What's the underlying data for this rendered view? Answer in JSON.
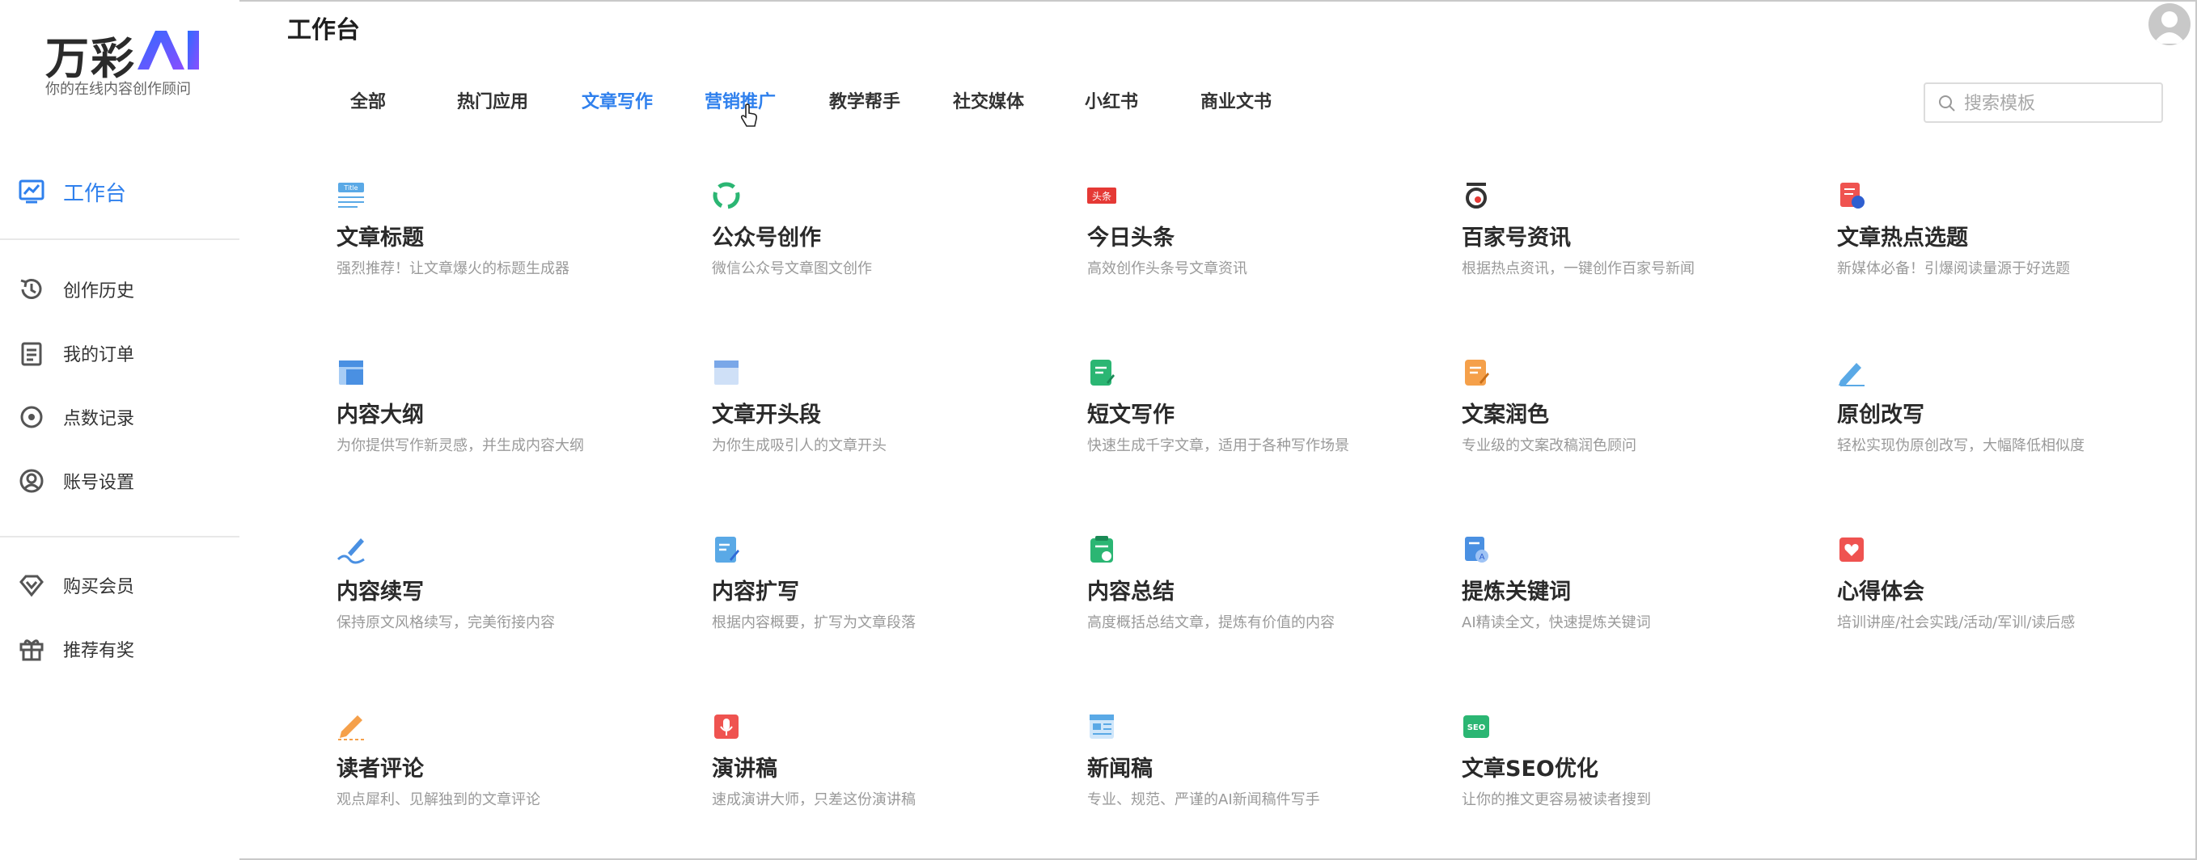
{
  "brand": {
    "name": "万彩",
    "ai": "AI",
    "tagline": "你的在线内容创作顾问"
  },
  "header": {
    "title": "工作台"
  },
  "sidebar": {
    "items": [
      {
        "label": "工作台",
        "icon": "dashboard-chart-icon"
      },
      {
        "label": "创作历史",
        "icon": "history-icon"
      },
      {
        "label": "我的订单",
        "icon": "clipboard-icon"
      },
      {
        "label": "点数记录",
        "icon": "points-icon"
      },
      {
        "label": "账号设置",
        "icon": "user-circle-icon"
      },
      {
        "label": "购买会员",
        "icon": "diamond-icon"
      },
      {
        "label": "推荐有奖",
        "icon": "gift-icon"
      }
    ]
  },
  "tabs": [
    "全部",
    "热门应用",
    "文章写作",
    "营销推广",
    "教学帮手",
    "社交媒体",
    "小红书",
    "商业文书"
  ],
  "active_tab": "文章写作",
  "search": {
    "placeholder": "搜索模板"
  },
  "cards": [
    {
      "title": "文章标题",
      "desc": "强烈推荐！让文章爆火的标题生成器",
      "icon": "title-doc-icon",
      "color": "#5aa9e6"
    },
    {
      "title": "公众号创作",
      "desc": "微信公众号文章图文创作",
      "icon": "wechat-mp-icon",
      "color": "#2bb673"
    },
    {
      "title": "今日头条",
      "desc": "高效创作头条号文章资讯",
      "icon": "toutiao-icon",
      "color": "#e53935"
    },
    {
      "title": "百家号资讯",
      "desc": "根据热点资讯，一键创作百家号新闻",
      "icon": "baijiahao-icon",
      "color": "#333333"
    },
    {
      "title": "文章热点选题",
      "desc": "新媒体必备！引爆阅读量源于好选题",
      "icon": "hot-topic-icon",
      "color": "#ef5350"
    },
    {
      "title": "内容大纲",
      "desc": "为你提供写作新灵感，并生成内容大纲",
      "icon": "outline-icon",
      "color": "#4a90e2"
    },
    {
      "title": "文章开头段",
      "desc": "为你生成吸引人的文章开头",
      "icon": "opening-icon",
      "color": "#7aa7e8"
    },
    {
      "title": "短文写作",
      "desc": "快速生成千字文章，适用于各种写作场景",
      "icon": "short-essay-icon",
      "color": "#2bb673"
    },
    {
      "title": "文案润色",
      "desc": "专业级的文案改稿润色顾问",
      "icon": "polish-icon",
      "color": "#f5a04a"
    },
    {
      "title": "原创改写",
      "desc": "轻松实现伪原创改写，大幅降低相似度",
      "icon": "rewrite-pen-icon",
      "color": "#5aa9e6"
    },
    {
      "title": "内容续写",
      "desc": "保持原文风格续写，完美衔接内容",
      "icon": "continue-write-icon",
      "color": "#4a90e2"
    },
    {
      "title": "内容扩写",
      "desc": "根据内容概要，扩写为文章段落",
      "icon": "expand-write-icon",
      "color": "#5aa9e6"
    },
    {
      "title": "内容总结",
      "desc": "高度概括总结文章，提炼有价值的内容",
      "icon": "summary-icon",
      "color": "#2bb673"
    },
    {
      "title": "提炼关键词",
      "desc": "AI精读全文，快速提炼关键词",
      "icon": "keyword-icon",
      "color": "#4a90e2"
    },
    {
      "title": "心得体会",
      "desc": "培训讲座/社会实践/活动/军训/读后感",
      "icon": "heart-note-icon",
      "color": "#ef5350"
    },
    {
      "title": "读者评论",
      "desc": "观点犀利、见解独到的文章评论",
      "icon": "comment-pen-icon",
      "color": "#f5a04a"
    },
    {
      "title": "演讲稿",
      "desc": "速成演讲大师，只差这份演讲稿",
      "icon": "speech-mic-icon",
      "color": "#ef5350"
    },
    {
      "title": "新闻稿",
      "desc": "专业、规范、严谨的AI新闻稿件写手",
      "icon": "news-icon",
      "color": "#5aa9e6"
    },
    {
      "title": "文章SEO优化",
      "desc": "让你的推文更容易被读者搜到",
      "icon": "seo-icon",
      "color": "#2bb673"
    }
  ]
}
